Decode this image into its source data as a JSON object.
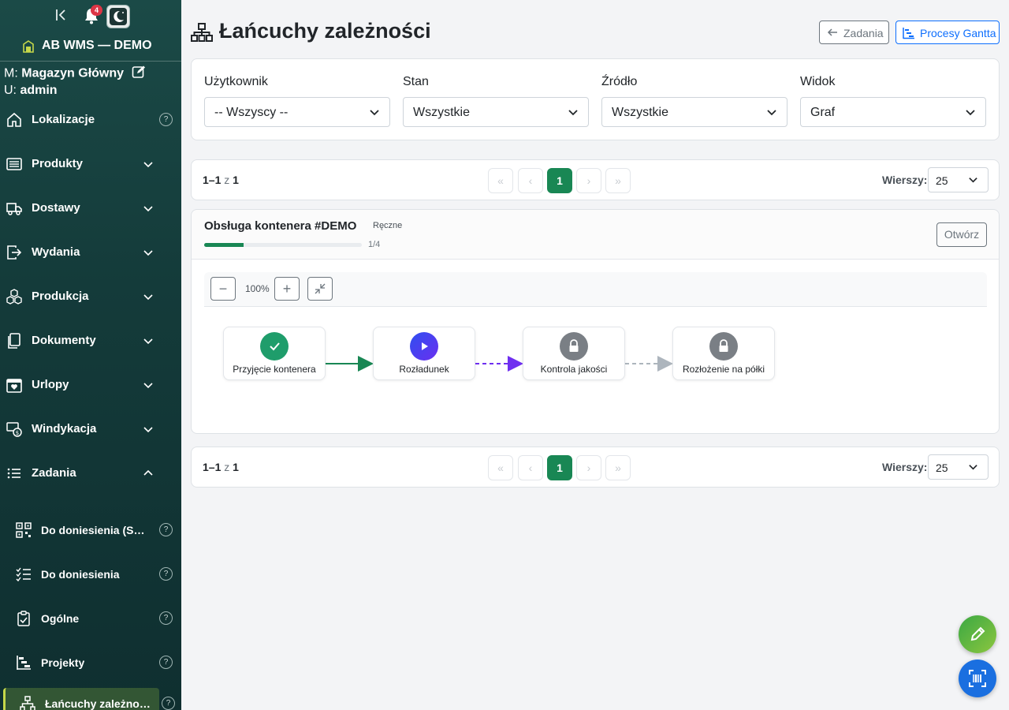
{
  "sidebar": {
    "notification_count": "4",
    "brand": "AB WMS — DEMO",
    "magazyn_prefix": "M:",
    "magazyn": "Magazyn Główny",
    "user_prefix": "U:",
    "user": "admin",
    "items": [
      {
        "label": "Lokalizacje",
        "icon": "home-icon",
        "help": "?"
      },
      {
        "label": "Produkty",
        "icon": "list-icon"
      },
      {
        "label": "Dostawy",
        "icon": "truck-icon"
      },
      {
        "label": "Wydania",
        "icon": "box-arrow-right-icon"
      },
      {
        "label": "Produkcja",
        "icon": "boxes-icon"
      },
      {
        "label": "Dokumenty",
        "icon": "documents-icon"
      },
      {
        "label": "Urlopy",
        "icon": "calendar-heart-icon"
      },
      {
        "label": "Windykacja",
        "icon": "cash-coin-icon"
      },
      {
        "label": "Zadania",
        "icon": "list-ul-icon"
      }
    ],
    "subitems": [
      {
        "label": "Do doniesienia (Skaner)",
        "icon": "qr-code-icon",
        "help": "?"
      },
      {
        "label": "Do doniesienia",
        "icon": "checklist-icon",
        "help": "?"
      },
      {
        "label": "Ogólne",
        "icon": "clipboard-check-icon",
        "help": "?"
      },
      {
        "label": "Projekty",
        "icon": "gantt-icon",
        "help": "?"
      },
      {
        "label": "Łańcuchy zależności",
        "icon": "diagram-icon",
        "help": "?"
      }
    ]
  },
  "header": {
    "title": "Łańcuchy zależności",
    "btn_tasks": "Zadania",
    "btn_gantt": "Procesy Gantta"
  },
  "filters": [
    {
      "label": "Użytkownik",
      "value": "-- Wszyscy --"
    },
    {
      "label": "Stan",
      "value": "Wszystkie"
    },
    {
      "label": "Źródło",
      "value": "Wszystkie"
    },
    {
      "label": "Widok",
      "value": "Graf"
    }
  ],
  "pager": {
    "range": "1–1",
    "of": "z",
    "total": "1",
    "first": "«",
    "prev": "‹",
    "current": "1",
    "next": "›",
    "last": "»",
    "rows_label": "Wierszy:",
    "rows_value": "25"
  },
  "chain": {
    "name": "Obsługa kontenera #DEMO",
    "type": "Ręczne",
    "progress": 0.25,
    "progress_text": "1/4",
    "open_label": "Otwórz",
    "zoom": "100%",
    "zoom_out": "−",
    "zoom_in": "+",
    "nodes": [
      {
        "label": "Przyjęcie kontenera",
        "state": "done",
        "color": "#1f9d6b"
      },
      {
        "label": "Rozładunek",
        "state": "active",
        "color": "#4a2ff0"
      },
      {
        "label": "Kontrola jakości",
        "state": "locked",
        "color": "#7a7f85"
      },
      {
        "label": "Rozłożenie na półki",
        "state": "locked",
        "color": "#7a7f85"
      }
    ],
    "edge_colors": [
      "#198754",
      "#6f2ff0",
      "#adb5bd"
    ]
  },
  "colors": {
    "accent": "#198754",
    "primary": "#0d6efd",
    "sidebar": "#143b3a"
  }
}
